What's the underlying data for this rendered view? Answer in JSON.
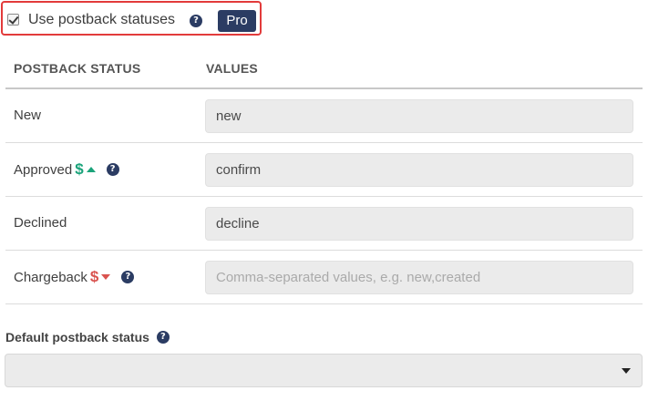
{
  "use_postback": {
    "checked": true,
    "label": "Use postback statuses",
    "badge": "Pro"
  },
  "table": {
    "headers": [
      "POSTBACK STATUS",
      "VALUES"
    ],
    "rows": [
      {
        "label": "New",
        "value": "new",
        "placeholder": ""
      },
      {
        "label": "Approved",
        "indicator": "$",
        "value": "confirm",
        "placeholder": ""
      },
      {
        "label": "Declined",
        "value": "decline",
        "placeholder": ""
      },
      {
        "label": "Chargeback",
        "indicator": "$",
        "value": "",
        "placeholder": "Comma-separated values, e.g. new,created"
      }
    ]
  },
  "default_status": {
    "label": "Default postback status",
    "selected": ""
  },
  "icons": {
    "help": "question-circle-icon",
    "up": "caret-up-icon",
    "down": "caret-down-icon",
    "dropdown": "chevron-down-icon"
  },
  "colors": {
    "highlight": "#e23b3b",
    "badge": "#2b3c63",
    "positive": "#1aa37a",
    "negative": "#d9534f"
  }
}
